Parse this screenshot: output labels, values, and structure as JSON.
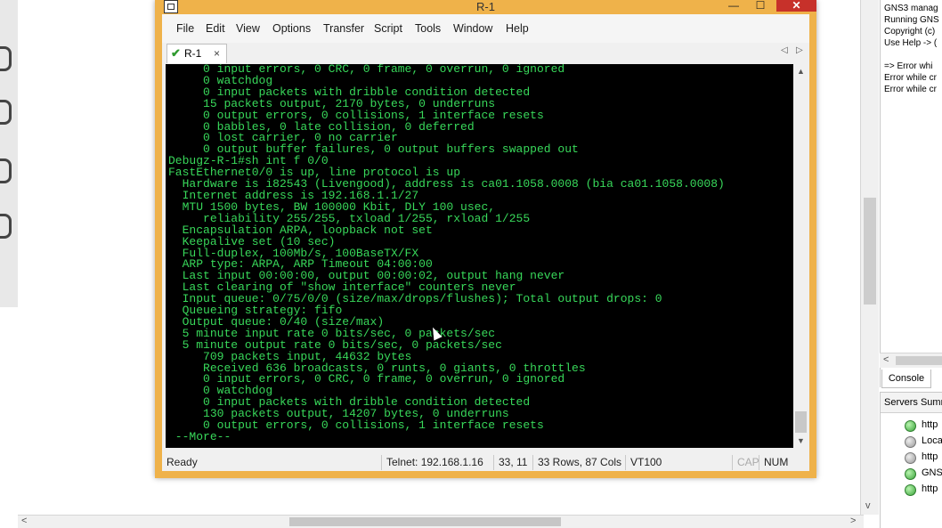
{
  "gns3": {
    "console_lines": [
      "GNS3 manag",
      "Running GNS",
      "Copyright (c)",
      "Use Help -> (",
      "",
      "=> Error whi",
      "Error while cr",
      "Error while cr"
    ],
    "console_tab": "Console",
    "servers_title": "Servers Summ",
    "servers": [
      {
        "label": "http",
        "status": "green"
      },
      {
        "label": "Loca",
        "status": "grey"
      },
      {
        "label": "http",
        "status": "grey"
      },
      {
        "label": "GNS",
        "status": "green"
      },
      {
        "label": "http",
        "status": "green"
      }
    ]
  },
  "crt": {
    "title": "R-1",
    "window_buttons": {
      "minimize": "—",
      "maximize": "☐",
      "close": "✕"
    },
    "menu": [
      "File",
      "Edit",
      "View",
      "Options",
      "Transfer",
      "Script",
      "Tools",
      "Window",
      "Help"
    ],
    "tab": {
      "check": "✔",
      "label": "R-1",
      "close": "×"
    },
    "tab_nav": {
      "prev": "◁",
      "next": "▷"
    },
    "terminal_lines": [
      "     0 input errors, 0 CRC, 0 frame, 0 overrun, 0 ignored",
      "     0 watchdog",
      "     0 input packets with dribble condition detected",
      "     15 packets output, 2170 bytes, 0 underruns",
      "     0 output errors, 0 collisions, 1 interface resets",
      "     0 babbles, 0 late collision, 0 deferred",
      "     0 lost carrier, 0 no carrier",
      "     0 output buffer failures, 0 output buffers swapped out",
      "Debugz-R-1#sh int f 0/0",
      "FastEthernet0/0 is up, line protocol is up",
      "  Hardware is i82543 (Livengood), address is ca01.1058.0008 (bia ca01.1058.0008)",
      "  Internet address is 192.168.1.1/27",
      "  MTU 1500 bytes, BW 100000 Kbit, DLY 100 usec,",
      "     reliability 255/255, txload 1/255, rxload 1/255",
      "  Encapsulation ARPA, loopback not set",
      "  Keepalive set (10 sec)",
      "  Full-duplex, 100Mb/s, 100BaseTX/FX",
      "  ARP type: ARPA, ARP Timeout 04:00:00",
      "  Last input 00:00:00, output 00:00:02, output hang never",
      "  Last clearing of \"show interface\" counters never",
      "  Input queue: 0/75/0/0 (size/max/drops/flushes); Total output drops: 0",
      "  Queueing strategy: fifo",
      "  Output queue: 0/40 (size/max)",
      "  5 minute input rate 0 bits/sec, 0 packets/sec",
      "  5 minute output rate 0 bits/sec, 0 packets/sec",
      "     709 packets input, 44632 bytes",
      "     Received 636 broadcasts, 0 runts, 0 giants, 0 throttles",
      "     0 input errors, 0 CRC, 0 frame, 0 overrun, 0 ignored",
      "     0 watchdog",
      "     0 input packets with dribble condition detected",
      "     130 packets output, 14207 bytes, 0 underruns",
      "     0 output errors, 0 collisions, 1 interface resets",
      " --More--"
    ],
    "status": {
      "ready": "Ready",
      "connection": "Telnet: 192.168.1.16",
      "cursor": "33, 11",
      "size": "33 Rows, 87 Cols",
      "emulation": "VT100",
      "cap": "CAP",
      "num": "NUM"
    },
    "colors": {
      "title_bar": "#efb24a",
      "terminal_bg": "#000000",
      "terminal_fg": "#38d85a",
      "close_button": "#c7312a"
    }
  }
}
